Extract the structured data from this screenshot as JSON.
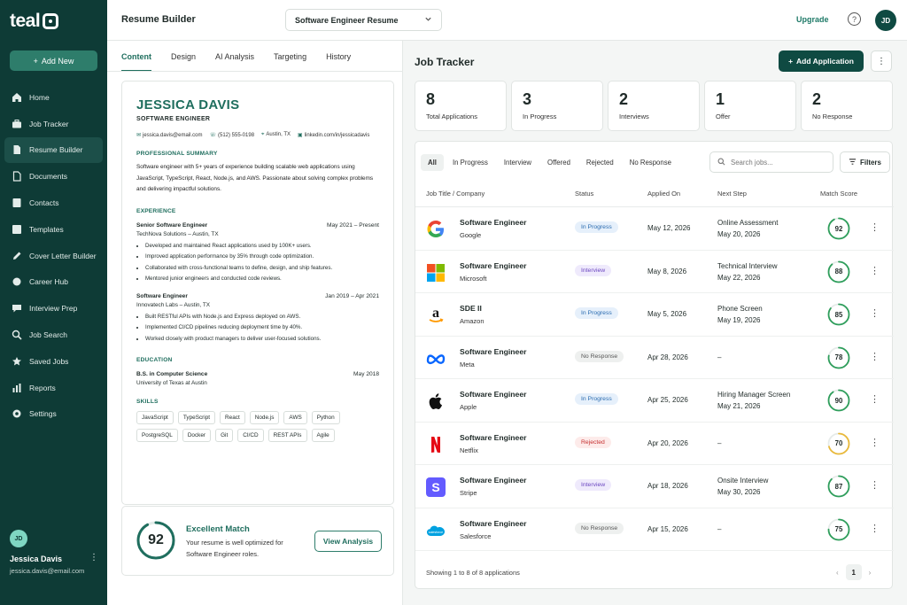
{
  "brand": {
    "logo_text": "teal"
  },
  "sidebar": {
    "add_new_label": "Add New",
    "items": [
      {
        "label": "Home",
        "icon": "home-icon",
        "active": false
      },
      {
        "label": "Job Tracker",
        "icon": "briefcase-icon",
        "active": false
      },
      {
        "label": "Resume Builder",
        "icon": "document-icon",
        "active": true
      },
      {
        "label": "Documents",
        "icon": "file-icon",
        "active": false
      },
      {
        "label": "Contacts",
        "icon": "contact-icon",
        "active": false
      },
      {
        "label": "Templates",
        "icon": "template-icon",
        "active": false
      },
      {
        "label": "Cover Letter Builder",
        "icon": "edit-icon",
        "active": false
      },
      {
        "label": "Career Hub",
        "icon": "hub-icon",
        "active": false
      },
      {
        "label": "Interview Prep",
        "icon": "chat-icon",
        "active": false
      },
      {
        "label": "Job Search",
        "icon": "search-icon",
        "active": false
      },
      {
        "label": "Saved Jobs",
        "icon": "star-icon",
        "active": false
      },
      {
        "label": "Reports",
        "icon": "chart-icon",
        "active": false
      },
      {
        "label": "Settings",
        "icon": "gear-icon",
        "active": false
      }
    ],
    "user": {
      "initials": "JD",
      "name": "Jessica Davis",
      "email": "jessica.davis@email.com"
    }
  },
  "header": {
    "page_title": "Resume Builder",
    "resume_select": "Software Engineer Resume",
    "upgrade_label": "Upgrade",
    "help": "?",
    "avatar_initials": "JD"
  },
  "resume_tabs": [
    "Content",
    "Design",
    "AI Analysis",
    "Targeting",
    "History"
  ],
  "resume": {
    "name": "JESSICA DAVIS",
    "title": "SOFTWARE ENGINEER",
    "email": "jessica.davis@email.com",
    "phone": "(512) 555-0198",
    "location": "Austin, TX",
    "linkedin": "linkedin.com/in/jessicadavis",
    "summary_heading": "PROFESSIONAL SUMMARY",
    "summary": "Software engineer with 5+ years of experience building scalable web applications using JavaScript, TypeScript, React, Node.js, and AWS. Passionate about solving complex problems and delivering impactful solutions.",
    "experience_heading": "EXPERIENCE",
    "jobs": [
      {
        "role": "Senior Software Engineer",
        "dates": "May 2021 – Present",
        "company": "TechNova Solutions – Austin, TX",
        "bullets": [
          "Developed and maintained React applications used by 100K+ users.",
          "Improved application performance by 35% through code optimization.",
          "Collaborated with cross-functional teams to define, design, and ship features.",
          "Mentored junior engineers and conducted code reviews."
        ]
      },
      {
        "role": "Software Engineer",
        "dates": "Jan 2019 – Apr 2021",
        "company": "Innovatech Labs – Austin, TX",
        "bullets": [
          "Built RESTful APIs with Node.js and Express deployed on AWS.",
          "Implemented CI/CD pipelines reducing deployment time by 40%.",
          "Worked closely with product managers to deliver user-focused solutions."
        ]
      }
    ],
    "education_heading": "EDUCATION",
    "degree": "B.S. in Computer Science",
    "degree_date": "May 2018",
    "school": "University of Texas at Austin",
    "skills_heading": "SKILLS",
    "skills": [
      "JavaScript",
      "TypeScript",
      "React",
      "Node.js",
      "AWS",
      "Python",
      "PostgreSQL",
      "Docker",
      "Git",
      "CI/CD",
      "REST APIs",
      "Agile"
    ]
  },
  "match": {
    "score": "92",
    "fraction": 0.92,
    "title": "Excellent Match",
    "text": "Your resume is well optimized for Software Engineer roles.",
    "button": "View Analysis"
  },
  "tracker": {
    "title": "Job Tracker",
    "add_button": "Add Application",
    "stats": [
      {
        "num": "8",
        "label": "Total Applications"
      },
      {
        "num": "3",
        "label": "In Progress"
      },
      {
        "num": "2",
        "label": "Interviews"
      },
      {
        "num": "1",
        "label": "Offer"
      },
      {
        "num": "2",
        "label": "No Response"
      }
    ],
    "filters": [
      "All",
      "In Progress",
      "Interview",
      "Offered",
      "Rejected",
      "No Response"
    ],
    "search_placeholder": "Search jobs...",
    "filters_button": "Filters",
    "columns": [
      "Job Title / Company",
      "Status",
      "Applied On",
      "Next Step",
      "Match Score"
    ],
    "rows": [
      {
        "title": "Software Engineer",
        "company": "Google",
        "logo": "google-logo-icon",
        "status": "In Progress",
        "applied": "May 12, 2026",
        "next": "Online Assessment",
        "next_date": "May 20, 2026",
        "score": "92",
        "score_frac": 0.92,
        "score_color": "#2e9e5b"
      },
      {
        "title": "Software Engineer",
        "company": "Microsoft",
        "logo": "microsoft-logo-icon",
        "status": "Interview",
        "applied": "May 8, 2026",
        "next": "Technical Interview",
        "next_date": "May 22, 2026",
        "score": "88",
        "score_frac": 0.88,
        "score_color": "#2e9e5b"
      },
      {
        "title": "SDE II",
        "company": "Amazon",
        "logo": "amazon-logo-icon",
        "status": "In Progress",
        "applied": "May 5, 2026",
        "next": "Phone Screen",
        "next_date": "May 19, 2026",
        "score": "85",
        "score_frac": 0.85,
        "score_color": "#2e9e5b"
      },
      {
        "title": "Software Engineer",
        "company": "Meta",
        "logo": "meta-logo-icon",
        "status": "No Response",
        "applied": "Apr 28, 2026",
        "next": "–",
        "next_date": "",
        "score": "78",
        "score_frac": 0.78,
        "score_color": "#2e9e5b"
      },
      {
        "title": "Software Engineer",
        "company": "Apple",
        "logo": "apple-logo-icon",
        "status": "In Progress",
        "applied": "Apr 25, 2026",
        "next": "Hiring Manager Screen",
        "next_date": "May 21, 2026",
        "score": "90",
        "score_frac": 0.9,
        "score_color": "#2e9e5b"
      },
      {
        "title": "Software Engineer",
        "company": "Netflix",
        "logo": "netflix-logo-icon",
        "status": "Rejected",
        "applied": "Apr 20, 2026",
        "next": "–",
        "next_date": "",
        "score": "70",
        "score_frac": 0.7,
        "score_color": "#e9b93a"
      },
      {
        "title": "Software Engineer",
        "company": "Stripe",
        "logo": "stripe-logo-icon",
        "status": "Interview",
        "applied": "Apr 18, 2026",
        "next": "Onsite Interview",
        "next_date": "May 30, 2026",
        "score": "87",
        "score_frac": 0.87,
        "score_color": "#2e9e5b"
      },
      {
        "title": "Software Engineer",
        "company": "Salesforce",
        "logo": "salesforce-logo-icon",
        "status": "No Response",
        "applied": "Apr 15, 2026",
        "next": "–",
        "next_date": "",
        "score": "75",
        "score_frac": 0.75,
        "score_color": "#2e9e5b"
      }
    ],
    "showing_text": "Showing 1 to 8 of 8 applications",
    "page": "1"
  },
  "colors": {
    "sidebar_bg": "#0e3b36",
    "accent": "#1f6e5e",
    "status_in_progress_bg": "#e6f0fb",
    "status_in_progress_fg": "#2b6cb0",
    "status_interview_bg": "#efeafc",
    "status_interview_fg": "#6b46c1",
    "status_no_response_bg": "#eef0ef",
    "status_no_response_fg": "#555555",
    "status_rejected_bg": "#fdebea",
    "status_rejected_fg": "#c53030"
  }
}
